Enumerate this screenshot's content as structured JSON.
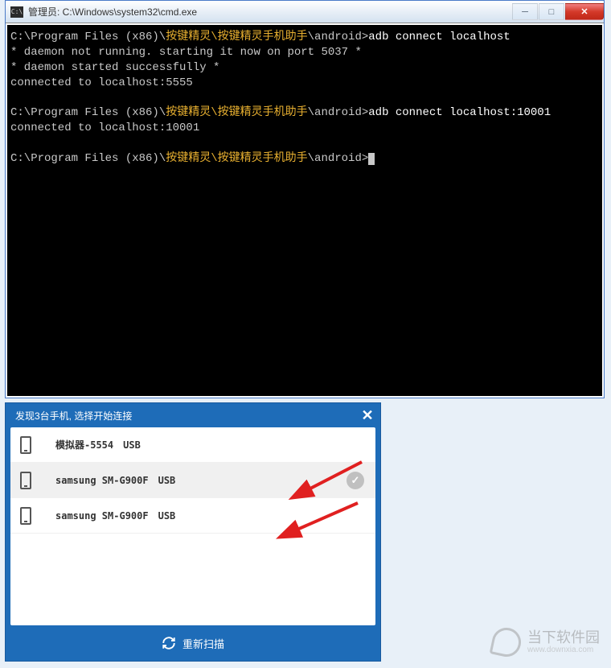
{
  "cmd": {
    "title": "管理员: C:\\Windows\\system32\\cmd.exe",
    "icon_label": "C:\\",
    "lines": [
      {
        "prompt": "C:\\Program Files (x86)\\",
        "path_cn": "按键精灵\\按键精灵手机助手",
        "path_end": "\\android>",
        "command": "adb connect localhost"
      },
      {
        "text": "* daemon not running. starting it now on port 5037 *"
      },
      {
        "text": "* daemon started successfully *"
      },
      {
        "text": "connected to localhost:5555"
      },
      {
        "text": ""
      },
      {
        "prompt": "C:\\Program Files (x86)\\",
        "path_cn": "按键精灵\\按键精灵手机助手",
        "path_end": "\\android>",
        "command": "adb connect localhost:10001"
      },
      {
        "text": "connected to localhost:10001"
      },
      {
        "text": ""
      },
      {
        "prompt": "C:\\Program Files (x86)\\",
        "path_cn": "按键精灵\\按键精灵手机助手",
        "path_end": "\\android>",
        "cursor": true
      }
    ]
  },
  "devices": {
    "title": "发现3台手机, 选择开始连接",
    "items": [
      {
        "name": "模拟器-5554",
        "connection": "USB",
        "selected": false
      },
      {
        "name": "samsung  SM-G900F",
        "connection": "USB",
        "selected": true
      },
      {
        "name": "samsung  SM-G900F",
        "connection": "USB",
        "selected": false
      }
    ],
    "rescan_label": "重新扫描"
  },
  "watermark": {
    "main": "当下软件园",
    "sub": "www.downxia.com"
  },
  "colors": {
    "accent_blue": "#1e6cb8",
    "terminal_bg": "#000000",
    "terminal_fg": "#c8c8c8",
    "close_red": "#d43a2a"
  }
}
